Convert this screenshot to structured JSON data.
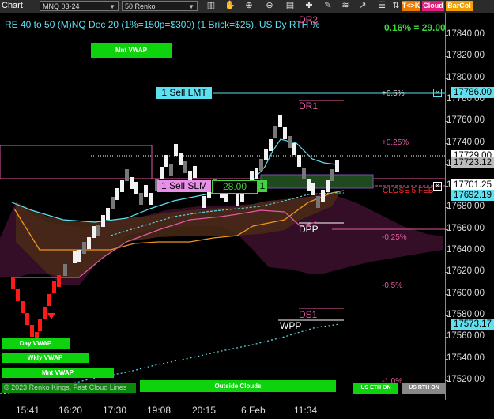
{
  "toolbar": {
    "title": "Chart",
    "instrument": "MNQ 03-24",
    "bar_type": "50 Renko",
    "tk_label": "T<>K",
    "cloud_label": "Cloud",
    "barcol_label": "BarCol",
    "colors": {
      "tk": "#f07a00",
      "cloud": "#e0207a",
      "barcol": "#f0a000"
    }
  },
  "header": {
    "indicator_text": "RE 40 to 50 (M)NQ Dec 20 (1%=150p=$300) (1 Brick=$25), US Dy RTH %",
    "pct_change": "0.16% = 29.00"
  },
  "price_axis": {
    "ticks": [
      "17840.00",
      "17820.00",
      "17800.00",
      "17780.00",
      "17760.00",
      "17740.00",
      "17720.00",
      "17700.00",
      "17680.00",
      "17660.00",
      "17640.00",
      "17620.00",
      "17600.00",
      "17580.00",
      "17560.00",
      "17540.00",
      "17520.00"
    ],
    "labels": [
      {
        "text": "17786.00",
        "bg": "#5de0f0",
        "fg": "#000"
      },
      {
        "text": "17729.00",
        "bg": "#ffffff",
        "fg": "#000"
      },
      {
        "text": "17723.12",
        "bg": "#bbbbbb",
        "fg": "#000"
      },
      {
        "text": "17701.25",
        "bg": "#ffffff",
        "fg": "#000"
      },
      {
        "text": "17692.19",
        "bg": "#5de0f0",
        "fg": "#000"
      },
      {
        "text": "17573.17",
        "bg": "#5de0f0",
        "fg": "#000"
      }
    ]
  },
  "time_axis": [
    "15:41",
    "16:20",
    "17:30",
    "19:08",
    "20:15",
    "6 Feb",
    "11:34"
  ],
  "orders": {
    "sell_limit": "1 Sell LMT",
    "sell_stop": "1 Sell SLM",
    "stop_price": "28.00",
    "quantity": "1",
    "close_label": "CLOSE 5 FEB",
    "close_icon": "×"
  },
  "levels": {
    "dr2": "DR2",
    "dr1": "DR1",
    "dpp": "DPP",
    "ds1": "DS1",
    "wpp": "WPP",
    "p05": "+0.5%",
    "p025": "+0.25%",
    "m025": "-0.25%",
    "m05": "-0.5%",
    "m1": "-1.0%"
  },
  "buttons": {
    "mnt_vwap_top": "Mnt VWAP",
    "day_vwap": "Day VWAP",
    "wkly_vwap": "Wkly VWAP",
    "mnt_vwap": "Mnt VWAP",
    "outside_clouds": "Outside Clouds",
    "us_eth_on": "US ETH ON",
    "us_rth_on": "US RTH ON"
  },
  "footer": {
    "copyright": "© 2023 Renko Kings, Fast Cloud Lines"
  }
}
